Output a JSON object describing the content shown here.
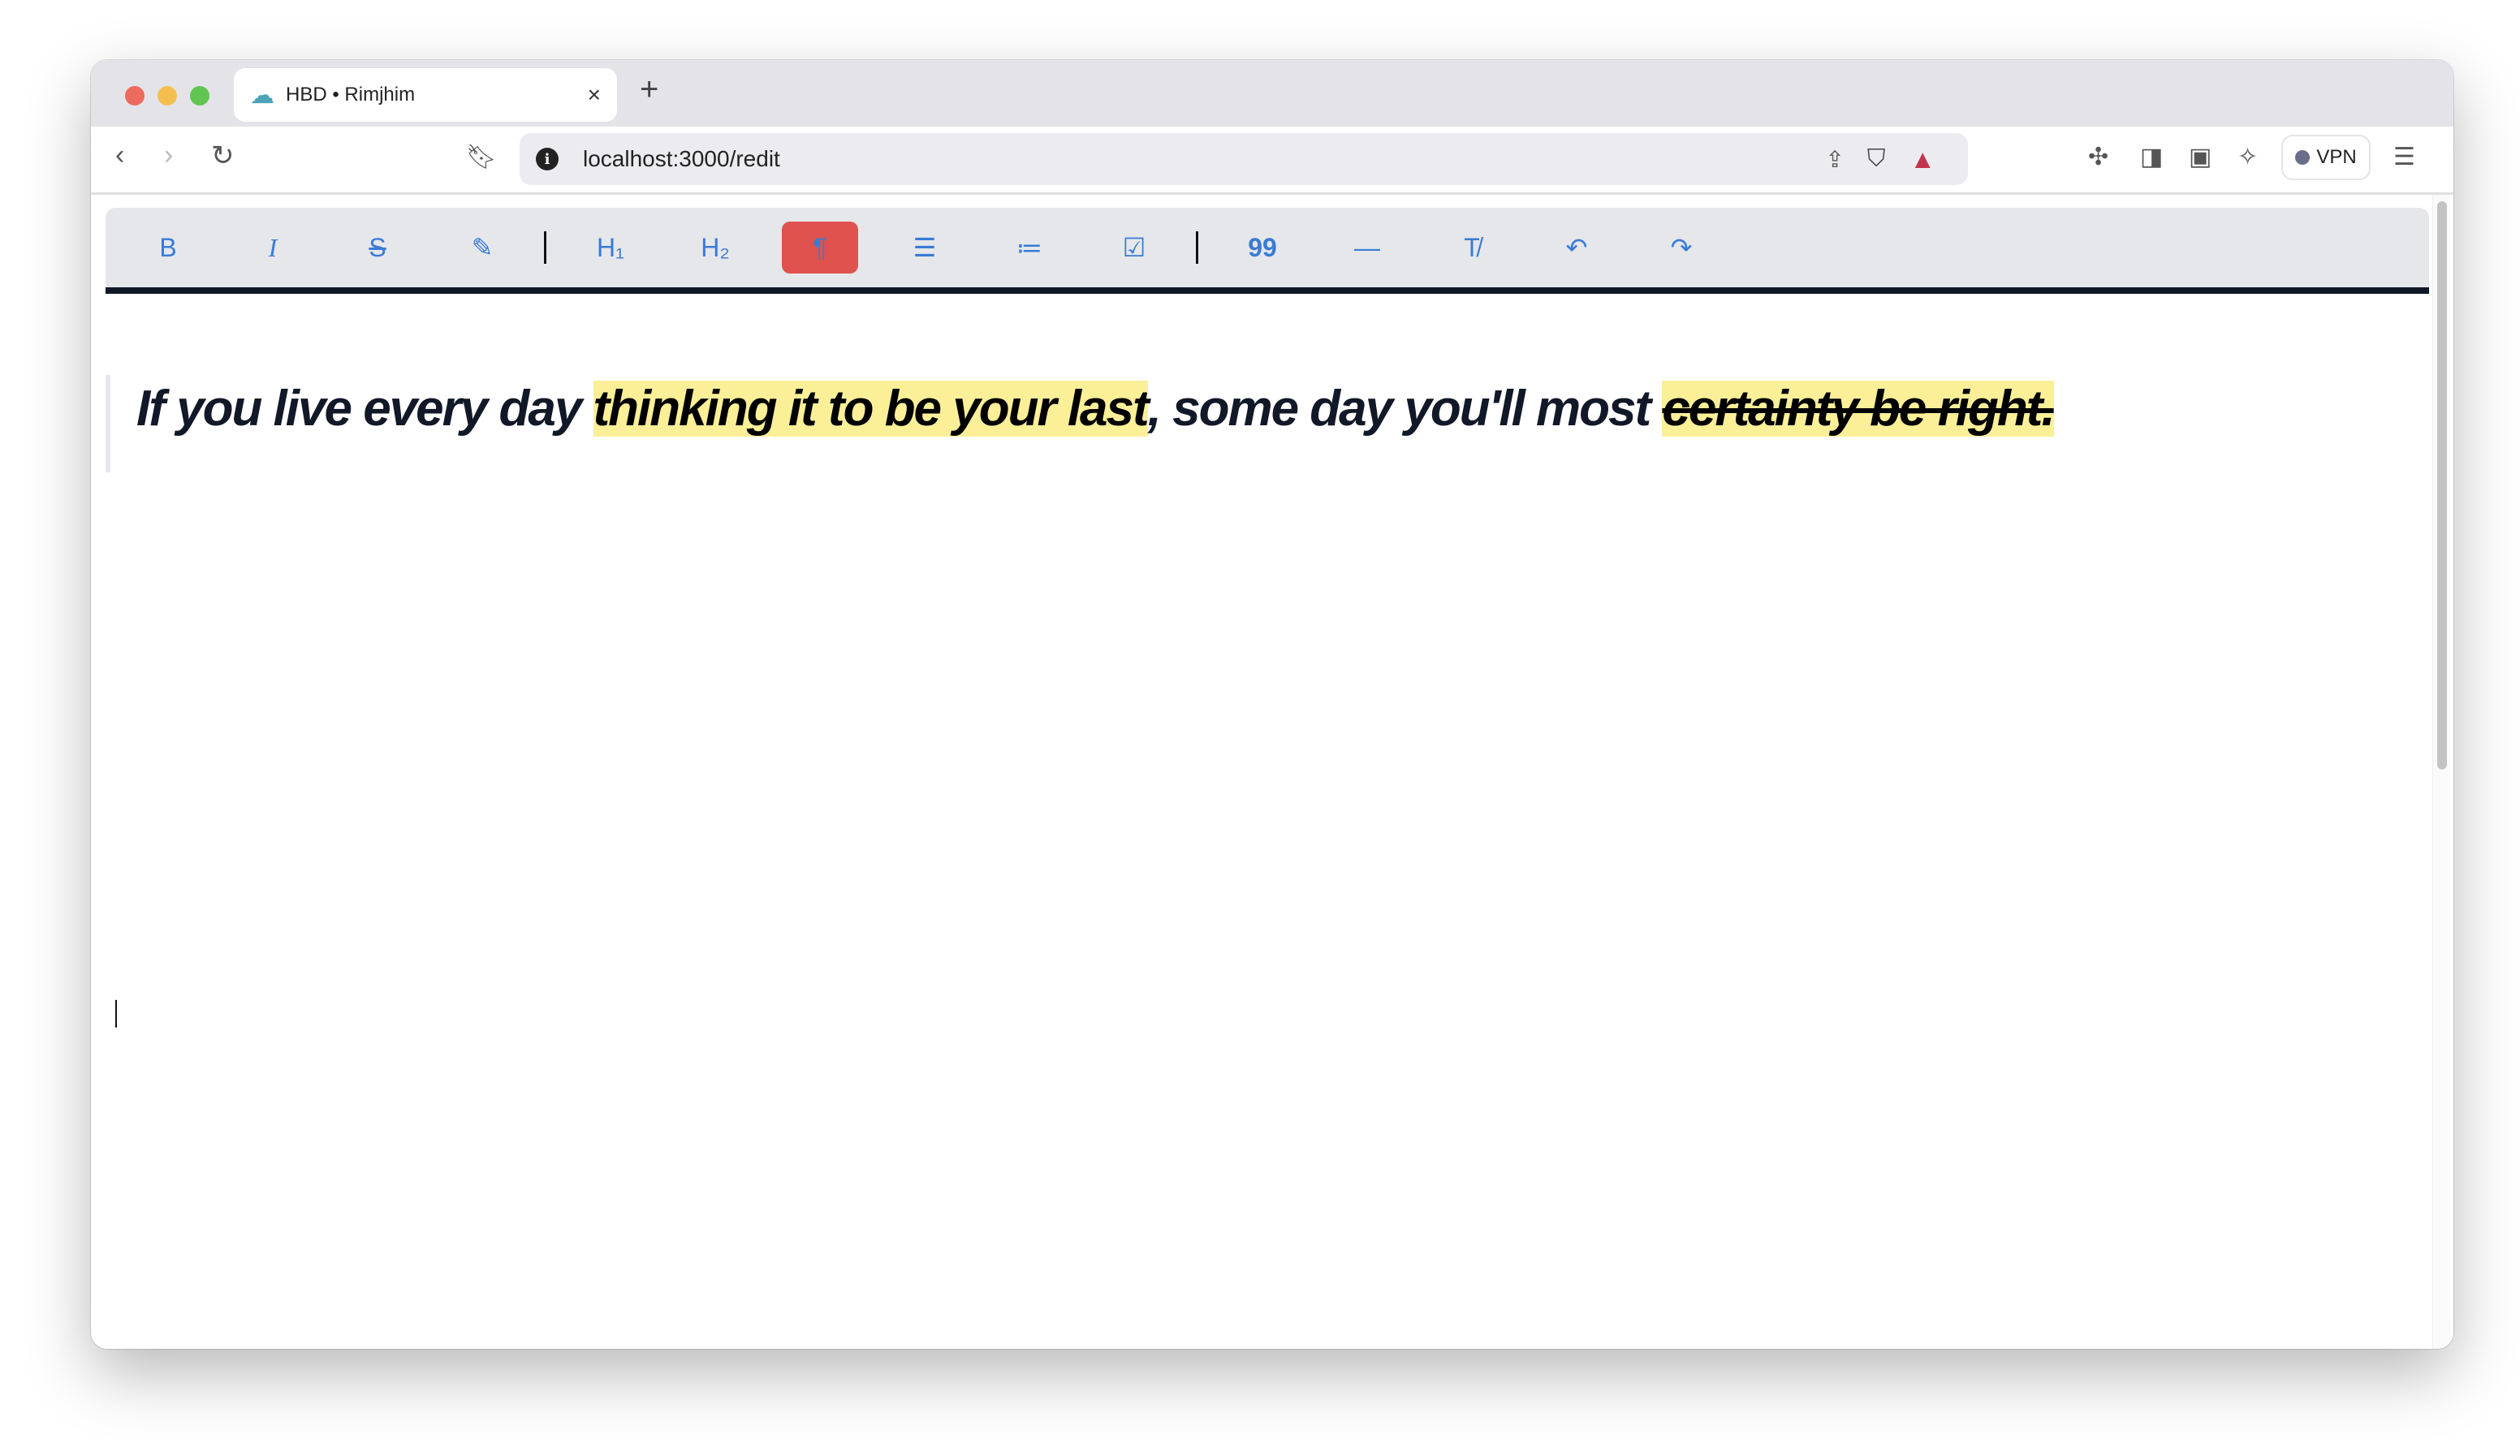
{
  "browser": {
    "tab_title": "HBD • Rimjhim",
    "tab_close": "×",
    "new_tab": "+",
    "url": "localhost:3000/redit",
    "vpn_label": "VPN",
    "traffic_lights": {
      "close": "#ec6a5e",
      "minimize": "#f5bf4f",
      "maximize": "#61c554"
    }
  },
  "toolbar": {
    "items": [
      {
        "name": "bold",
        "label": "B"
      },
      {
        "name": "italic",
        "label": "I"
      },
      {
        "name": "strikethrough",
        "label": "S"
      },
      {
        "name": "highlight",
        "label": "✎"
      },
      {
        "name": "heading-1",
        "label": "H₁"
      },
      {
        "name": "heading-2",
        "label": "H₂"
      },
      {
        "name": "paragraph",
        "label": "¶",
        "active": true
      },
      {
        "name": "bullet-list",
        "label": "☰"
      },
      {
        "name": "ordered-list",
        "label": "≔"
      },
      {
        "name": "task-list",
        "label": "☑"
      },
      {
        "name": "blockquote",
        "label": "99"
      },
      {
        "name": "horizontal-rule",
        "label": "—"
      },
      {
        "name": "clear-format",
        "label": "T̸"
      },
      {
        "name": "undo",
        "label": "↶"
      },
      {
        "name": "redo",
        "label": "↷"
      }
    ],
    "accent": "#3a7bd5",
    "active_color": "#e0524d"
  },
  "editor": {
    "segments": [
      {
        "text": "If you live every day ",
        "highlight": false,
        "strike": false
      },
      {
        "text": "thinking it to be your last",
        "highlight": true,
        "strike": false
      },
      {
        "text": ", some day you'll most ",
        "highlight": false,
        "strike": false
      },
      {
        "text": "certainty be right.",
        "highlight": true,
        "strike": true
      }
    ],
    "highlight_color": "#fbef98"
  }
}
